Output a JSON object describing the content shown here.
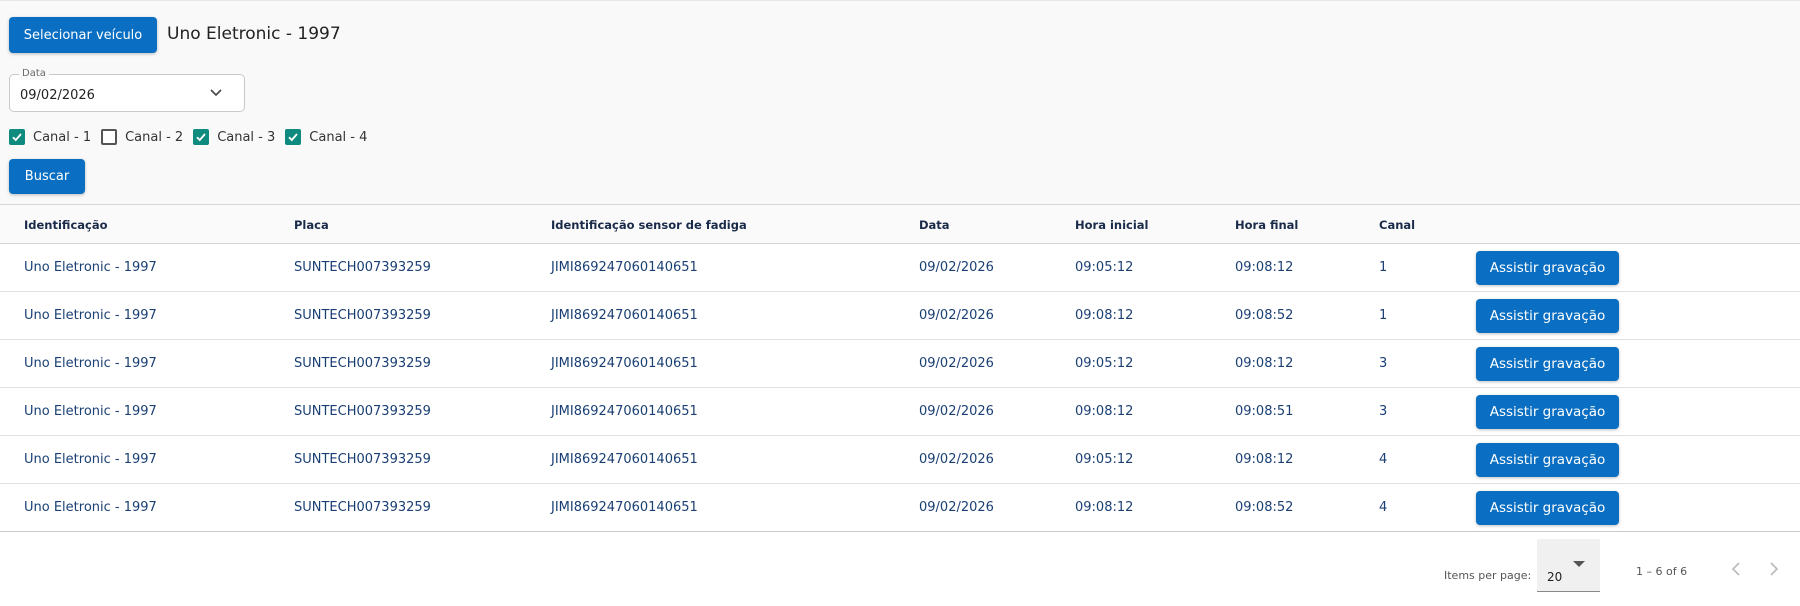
{
  "header": {
    "select_vehicle_label": "Selecionar veículo",
    "vehicle_name": "Uno Eletronic - 1997"
  },
  "filters": {
    "date_label": "Data",
    "date_value": "09/02/2026",
    "channels": [
      {
        "label": "Canal - 1",
        "checked": true
      },
      {
        "label": "Canal - 2",
        "checked": false
      },
      {
        "label": "Canal - 3",
        "checked": true
      },
      {
        "label": "Canal - 4",
        "checked": true
      }
    ],
    "search_label": "Buscar"
  },
  "table": {
    "columns": [
      "Identificação",
      "Placa",
      "Identificação sensor de fadiga",
      "Data",
      "Hora inicial",
      "Hora final",
      "Canal"
    ],
    "action_label": "Assistir gravação",
    "rows": [
      [
        "Uno Eletronic - 1997",
        "SUNTECH007393259",
        "JIMI869247060140651",
        "09/02/2026",
        "09:05:12",
        "09:08:12",
        "1"
      ],
      [
        "Uno Eletronic - 1997",
        "SUNTECH007393259",
        "JIMI869247060140651",
        "09/02/2026",
        "09:08:12",
        "09:08:52",
        "1"
      ],
      [
        "Uno Eletronic - 1997",
        "SUNTECH007393259",
        "JIMI869247060140651",
        "09/02/2026",
        "09:05:12",
        "09:08:12",
        "3"
      ],
      [
        "Uno Eletronic - 1997",
        "SUNTECH007393259",
        "JIMI869247060140651",
        "09/02/2026",
        "09:08:12",
        "09:08:51",
        "3"
      ],
      [
        "Uno Eletronic - 1997",
        "SUNTECH007393259",
        "JIMI869247060140651",
        "09/02/2026",
        "09:05:12",
        "09:08:12",
        "4"
      ],
      [
        "Uno Eletronic - 1997",
        "SUNTECH007393259",
        "JIMI869247060140651",
        "09/02/2026",
        "09:08:12",
        "09:08:52",
        "4"
      ]
    ]
  },
  "paginator": {
    "items_per_page_label": "Items per page:",
    "items_per_page_value": "20",
    "range_label": "1 – 6 of 6"
  },
  "colors": {
    "primary": "#0a6fc2",
    "checkbox_checked": "#0f8a7e",
    "text_dark_blue": "#1a3f75"
  }
}
